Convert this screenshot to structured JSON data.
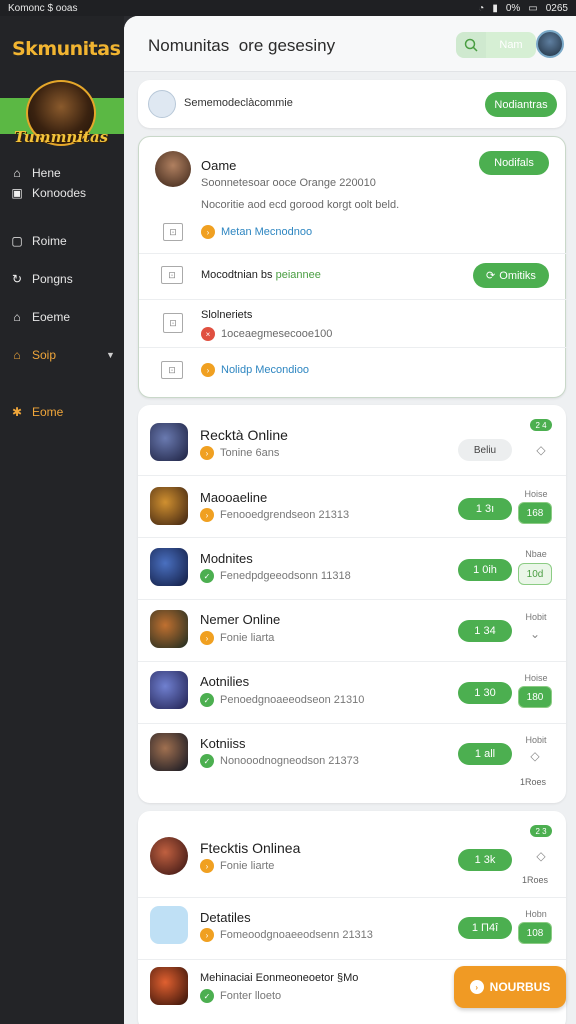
{
  "status_bar": {
    "left": "Komonc $ ooas",
    "right": "0″% □ ˘f26б",
    "time": "0%",
    "battery": "0265"
  },
  "sidebar": {
    "logo": "Skmunitas",
    "mascot_text": "Tummnitas",
    "items": [
      {
        "label": "Hene",
        "icon": "home-icon"
      },
      {
        "label": "Konoodes",
        "icon": "bookmark-icon"
      },
      {
        "label": "Roime",
        "icon": "square-icon"
      },
      {
        "label": "Pongns",
        "icon": "refresh-icon"
      },
      {
        "label": "Eoeme",
        "icon": "lock-icon"
      },
      {
        "label": "Soip",
        "icon": "home-icon"
      },
      {
        "label": "Eome",
        "icon": "star-icon"
      }
    ]
  },
  "topbar": {
    "title": "Nomunitas  ore gesesiny",
    "name_pill": "Nam",
    "search_icon": "search-icon"
  },
  "notice_card": {
    "label": "Sememodeclàcommie",
    "button": "Nodiantras"
  },
  "detail_card": {
    "heading": "Oame",
    "subtitle": "Soonnetesoar ooce Orange 220010",
    "description": "Nocoritie aod ecd gorood korgt oolt beld.",
    "link1": "Metan Mecnodnoo",
    "row2_label": "Mocodtnian bs",
    "row2_link": "peiannee",
    "row2_button": "Omitiks",
    "row3_title": "Slolneriets",
    "row3_sub": "1oceaegmesecooe100",
    "link3": "Nolidp Mecondioo",
    "top_button": "Nodifals",
    "icon1": "image-icon",
    "icon2": "image-icon",
    "icon3": "image-icon",
    "icon4": "image-icon"
  },
  "games_card_1": {
    "badge": "2 4",
    "header": {
      "name": "Recktà Online",
      "sub": "Tonine 6ans",
      "button": "Beliu"
    },
    "rows": [
      {
        "name": "Maooaeline",
        "sub": "Fenooedgrendseon 21313",
        "button": "1 3ı",
        "side_label": "Hoise",
        "side_box": "168"
      },
      {
        "name": "Modnites",
        "sub": "Fenedpdgeeodsonn 11318",
        "button": "1 0ih",
        "side_label": "Nbae",
        "side_box": "10d"
      },
      {
        "name": "Nemer Online",
        "sub": "Fonie liarta",
        "button": "1 34",
        "side_label": "Hobit",
        "side_box": ""
      },
      {
        "name": "Aotnilies",
        "sub": "Penoedgnoaeeodseon 21310",
        "button": "1 30",
        "side_label": "Hoise",
        "side_box": "180"
      },
      {
        "name": "Kotniiss",
        "sub": "Nonooodnogneodson 21373",
        "button": "1 all",
        "side_label": "Hobit",
        "side_box": ""
      }
    ],
    "footer": "1Roes"
  },
  "games_card_2": {
    "badge": "2 3",
    "header": {
      "name": "Ftecktis Onlinea",
      "sub": "Fonie liarte",
      "button": "1 3k",
      "side_label": "1Roes"
    },
    "rows": [
      {
        "name": "Detatiles",
        "sub": "Fomeoodgnoaeeodsenn 21313",
        "button": "1 Π4î",
        "side_label": "Hobn",
        "side_box": "108"
      },
      {
        "name": "Mehinaciai Eonmeoneoetor §Mo",
        "sub": "Fonter lloeto",
        "button": ""
      }
    ]
  },
  "cta_button": "NOURBUS"
}
